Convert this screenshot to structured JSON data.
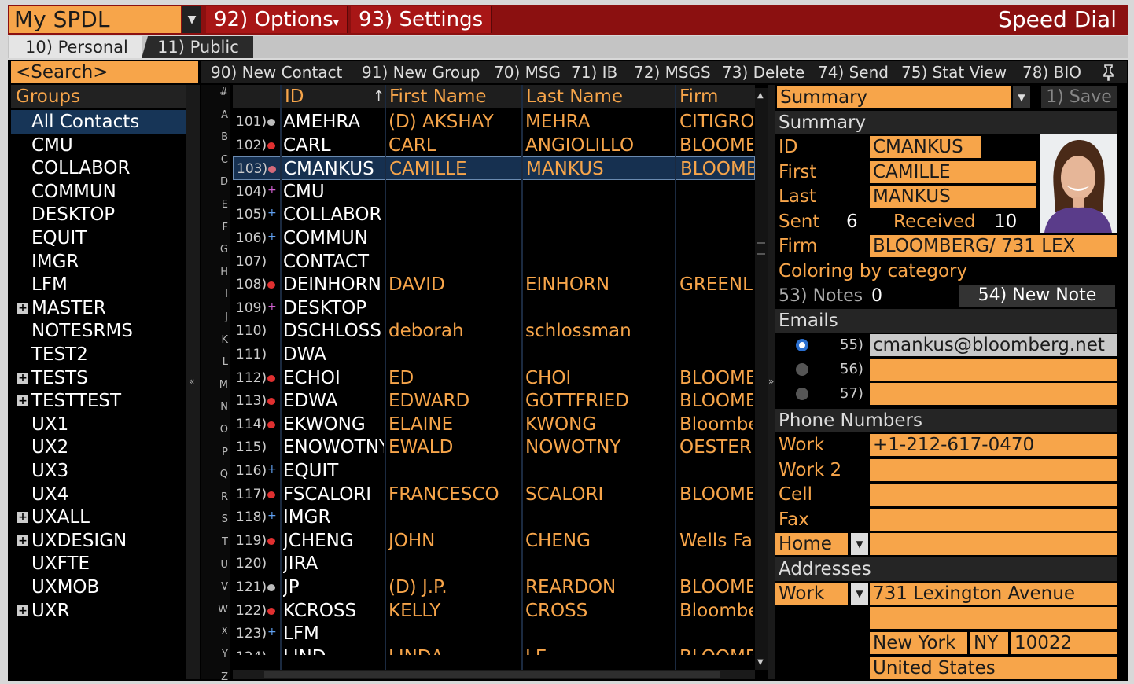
{
  "header": {
    "title": "My SPDL",
    "options": "92) Options",
    "settings": "93) Settings",
    "speed_dial": "Speed Dial"
  },
  "tabs": [
    {
      "label": "10) Personal",
      "active": true
    },
    {
      "label": "11) Public",
      "active": false
    }
  ],
  "search": {
    "placeholder": "<Search>"
  },
  "toolbar": {
    "new_contact": "90) New Contact",
    "new_group": "91) New Group",
    "msg": "70) MSG",
    "ib": "71) IB",
    "msgs": "72) MSGS",
    "delete": "73) Delete",
    "send": "74) Send",
    "stat_view": "75) Stat View",
    "bio": "78) BIO"
  },
  "groups": {
    "header": "Groups",
    "items": [
      {
        "label": "All Contacts",
        "selected": true,
        "expandable": false
      },
      {
        "label": "CMU",
        "expandable": false
      },
      {
        "label": "COLLABOR",
        "expandable": false
      },
      {
        "label": "COMMUN",
        "expandable": false
      },
      {
        "label": "DESKTOP",
        "expandable": false
      },
      {
        "label": "EQUIT",
        "expandable": false
      },
      {
        "label": "IMGR",
        "expandable": false
      },
      {
        "label": "LFM",
        "expandable": false
      },
      {
        "label": "MASTER",
        "expandable": true
      },
      {
        "label": "NOTESRMS",
        "expandable": false
      },
      {
        "label": "TEST2",
        "expandable": false
      },
      {
        "label": "TESTS",
        "expandable": true
      },
      {
        "label": "TESTTEST",
        "expandable": true
      },
      {
        "label": "UX1",
        "expandable": false
      },
      {
        "label": "UX2",
        "expandable": false
      },
      {
        "label": "UX3",
        "expandable": false
      },
      {
        "label": "UX4",
        "expandable": false
      },
      {
        "label": "UXALL",
        "expandable": true
      },
      {
        "label": "UXDESIGN",
        "expandable": true
      },
      {
        "label": "UXFTE",
        "expandable": false
      },
      {
        "label": "UXMOB",
        "expandable": false
      },
      {
        "label": "UXR",
        "expandable": true
      }
    ]
  },
  "alpha_index": [
    "#",
    "A",
    "B",
    "C",
    "D",
    "E",
    "F",
    "G",
    "H",
    "I",
    "J",
    "K",
    "L",
    "M",
    "N",
    "O",
    "P",
    "Q",
    "R",
    "S",
    "T",
    "U",
    "V",
    "W",
    "X",
    "Y",
    "Z"
  ],
  "grid": {
    "columns": {
      "id": "ID",
      "first": "First Name",
      "last": "Last Name",
      "firm": "Firm"
    },
    "rows": [
      {
        "num": "101)",
        "icon": "grey",
        "id": "AMEHRA",
        "first": "(D) AKSHAY",
        "last": "MEHRA",
        "firm": "CITIGROUP"
      },
      {
        "num": "102)",
        "icon": "red",
        "id": "CARL",
        "first": "CARL",
        "last": "ANGIOLILLO",
        "firm": "BLOOMBERG"
      },
      {
        "num": "103)",
        "icon": "pink",
        "id": "CMANKUS",
        "first": "CAMILLE",
        "last": "MANKUS",
        "firm": "BLOOMBERG",
        "selected": true
      },
      {
        "num": "104)",
        "icon": "magenta",
        "id": "CMU",
        "first": "",
        "last": "",
        "firm": ""
      },
      {
        "num": "105)",
        "icon": "blue",
        "id": "COLLABOR",
        "first": "",
        "last": "",
        "firm": ""
      },
      {
        "num": "106)",
        "icon": "blue",
        "id": "COMMUN",
        "first": "",
        "last": "",
        "firm": ""
      },
      {
        "num": "107)",
        "icon": "none",
        "id": "CONTACT",
        "first": "",
        "last": "",
        "firm": ""
      },
      {
        "num": "108)",
        "icon": "red",
        "id": "DEINHORN",
        "first": "DAVID",
        "last": "EINHORN",
        "firm": "GREENLIGHT"
      },
      {
        "num": "109)",
        "icon": "magenta",
        "id": "DESKTOP",
        "first": "",
        "last": "",
        "firm": ""
      },
      {
        "num": "110)",
        "icon": "none",
        "id": "DSCHLOSS",
        "first": "deborah",
        "last": "schlossman",
        "firm": ""
      },
      {
        "num": "111)",
        "icon": "none",
        "id": "DWA",
        "first": "",
        "last": "",
        "firm": ""
      },
      {
        "num": "112)",
        "icon": "red",
        "id": "ECHOI",
        "first": "ED",
        "last": "CHOI",
        "firm": "BLOOMBERG"
      },
      {
        "num": "113)",
        "icon": "red",
        "id": "EDWA",
        "first": "EDWARD",
        "last": "GOTTFRIED",
        "firm": "BLOOMBERG"
      },
      {
        "num": "114)",
        "icon": "red",
        "id": "EKWONG",
        "first": "ELAINE",
        "last": "KWONG",
        "firm": "Bloomberg"
      },
      {
        "num": "115)",
        "icon": "none",
        "id": "ENOWOTNY",
        "first": "EWALD",
        "last": "NOWOTNY",
        "firm": "OESTERR"
      },
      {
        "num": "116)",
        "icon": "blue",
        "id": "EQUIT",
        "first": "",
        "last": "",
        "firm": ""
      },
      {
        "num": "117)",
        "icon": "red",
        "id": "FSCALORI",
        "first": "FRANCESCO",
        "last": "SCALORI",
        "firm": "BLOOMBERG"
      },
      {
        "num": "118)",
        "icon": "blue",
        "id": "IMGR",
        "first": "",
        "last": "",
        "firm": ""
      },
      {
        "num": "119)",
        "icon": "red",
        "id": "JCHENG",
        "first": "JOHN",
        "last": "CHENG",
        "firm": "Wells Fargo"
      },
      {
        "num": "120)",
        "icon": "none",
        "id": "JIRA",
        "first": "",
        "last": "",
        "firm": ""
      },
      {
        "num": "121)",
        "icon": "grey",
        "id": "JP",
        "first": "(D) J.P.",
        "last": "REARDON",
        "firm": "BLOOMBERG"
      },
      {
        "num": "122)",
        "icon": "red",
        "id": "KCROSS",
        "first": "KELLY",
        "last": "CROSS",
        "firm": "Bloomberg"
      },
      {
        "num": "123)",
        "icon": "blue",
        "id": "LFM",
        "first": "",
        "last": "",
        "firm": ""
      },
      {
        "num": "124)",
        "icon": "none",
        "id": "LIND",
        "first": "LINDA",
        "last": "LE",
        "firm": "BLOOMBERG"
      }
    ]
  },
  "detail": {
    "view_select": "Summary",
    "save": "1) Save",
    "summary_header": "Summary",
    "id_label": "ID",
    "id": "CMANKUS",
    "first_label": "First",
    "first": "CAMILLE",
    "last_label": "Last",
    "last": "MANKUS",
    "sent_label": "Sent",
    "sent": "6",
    "received_label": "Received",
    "received": "10",
    "firm_label": "Firm",
    "firm": "BLOOMBERG/ 731 LEX",
    "coloring": "Coloring by category",
    "notes_label": "53) Notes",
    "notes": "0",
    "new_note": "54) New Note",
    "emails_header": "Emails",
    "emails": [
      {
        "num": "55)",
        "value": "cmankus@bloomberg.net",
        "selected": true
      },
      {
        "num": "56)",
        "value": "",
        "selected": false
      },
      {
        "num": "57)",
        "value": "",
        "selected": false
      }
    ],
    "phones_header": "Phone Numbers",
    "phones": [
      {
        "label": "Work",
        "value": "+1-212-617-0470"
      },
      {
        "label": "Work 2",
        "value": ""
      },
      {
        "label": "Cell",
        "value": ""
      },
      {
        "label": "Fax",
        "value": ""
      }
    ],
    "phone_select": "Home",
    "addresses_header": "Addresses",
    "address_select": "Work",
    "street": "731 Lexington Avenue",
    "city": "New York",
    "state": "NY",
    "zip": "10022",
    "country": "United States"
  },
  "colors": {
    "accent": "#f7a54a",
    "header_red": "#8b1010",
    "selection": "#163050"
  }
}
